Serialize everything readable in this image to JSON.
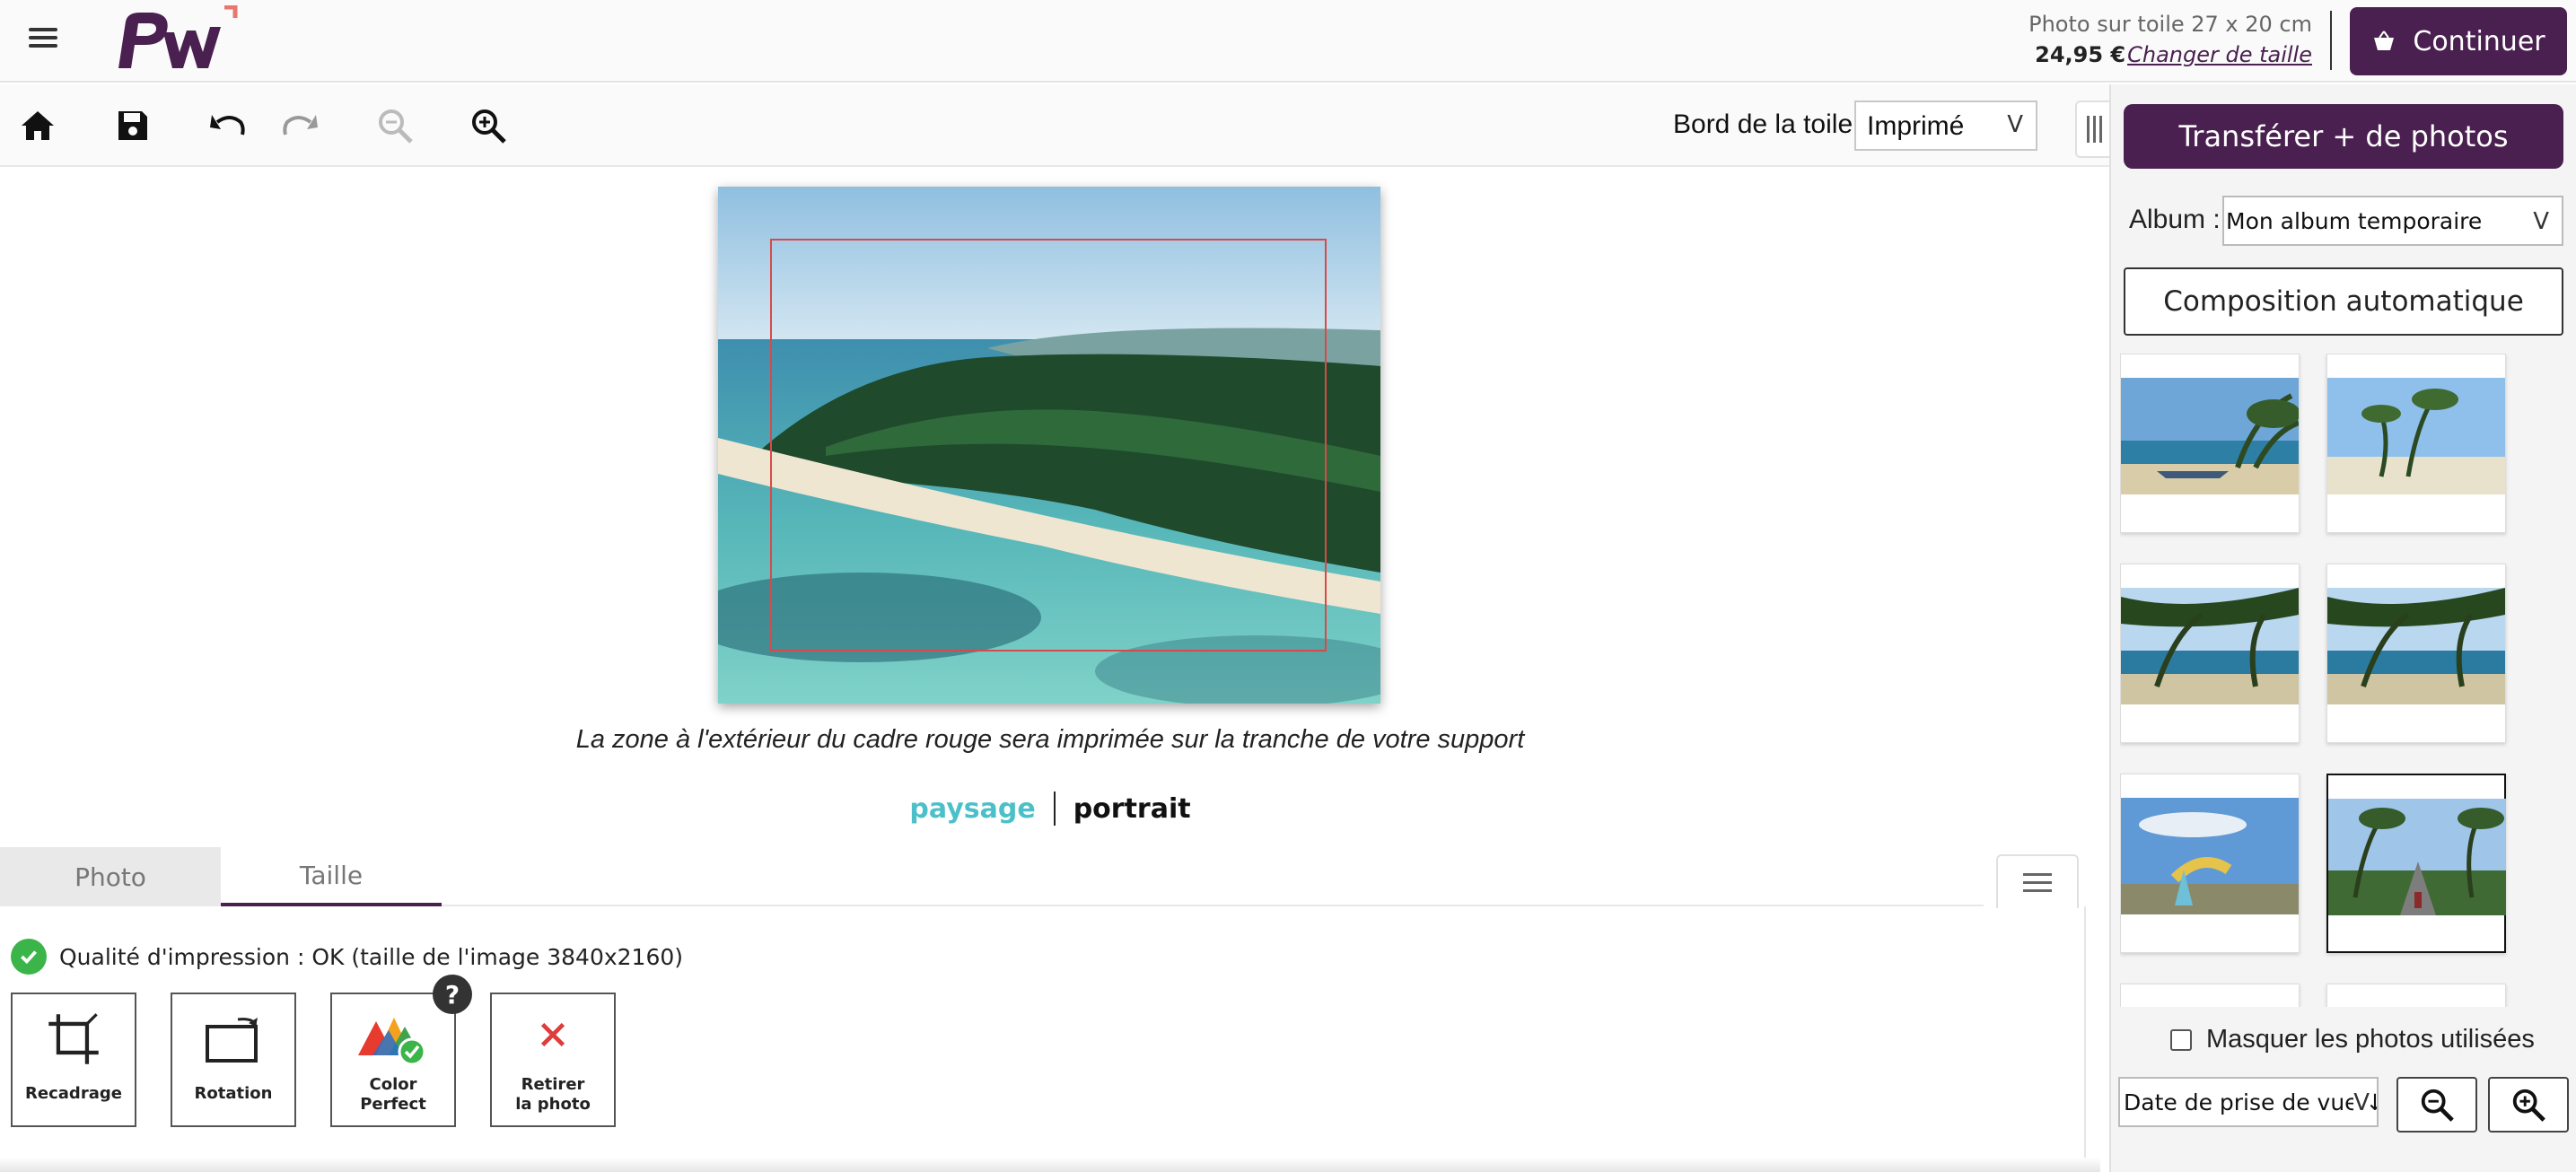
{
  "header": {
    "product_name": "Photo sur toile 27 x 20 cm",
    "price": "24,95 €",
    "change_size_link": "Changer de taille",
    "continue_label": "Continuer"
  },
  "toolbar": {
    "icons": [
      "home-icon",
      "save-icon",
      "undo-icon",
      "redo-icon",
      "zoom-out-icon",
      "zoom-in-icon"
    ],
    "border_label": "Bord de la toile :",
    "border_value": "Imprimé"
  },
  "canvas": {
    "caption": "La zone à l'extérieur du cadre rouge sera imprimée sur la tranche de votre support",
    "orientation_landscape": "paysage",
    "orientation_portrait": "portrait",
    "active_orientation": "paysage"
  },
  "tabs": {
    "photo": "Photo",
    "size": "Taille",
    "active": "Taille"
  },
  "quality": {
    "text": "Qualité d'impression : OK (taille de l'image 3840x2160)"
  },
  "tools": {
    "crop": "Recadrage",
    "rotate": "Rotation",
    "color_line1": "Color",
    "color_line2": "Perfect",
    "remove_line1": "Retirer",
    "remove_line2": "la photo",
    "help": "?"
  },
  "sidebar": {
    "upload_label": "Transférer + de photos",
    "album_label": "Album :",
    "album_value": "Mon album temporaire",
    "auto_compose_label": "Composition automatique",
    "hide_used_label": "Masquer les photos utilisées",
    "hide_used_checked": false,
    "sort_value": "Date de prise de vue ↓",
    "selected_thumbnail_index": 5
  },
  "colors": {
    "brand": "#4a2050",
    "accent_teal": "#4bc0c8",
    "ok_green": "#3bb54a",
    "safe_frame": "#d84a4a"
  }
}
